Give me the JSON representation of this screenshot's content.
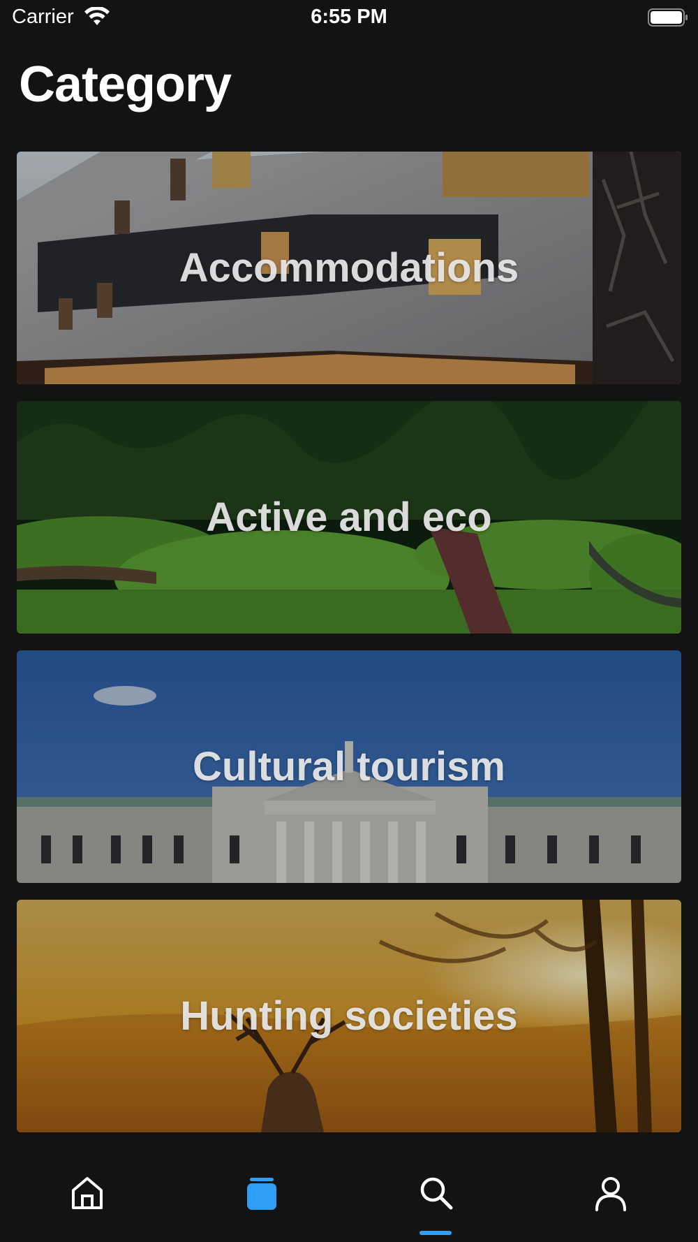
{
  "status_bar": {
    "carrier": "Carrier",
    "time": "6:55 PM",
    "wifi_icon": "wifi-icon",
    "battery_icon": "battery-full-icon"
  },
  "header": {
    "title": "Category"
  },
  "categories": [
    {
      "label": "Accommodations",
      "image": "modern-building-photo"
    },
    {
      "label": "Active and eco",
      "image": "green-park-path-photo"
    },
    {
      "label": "Cultural tourism",
      "image": "classical-building-photo"
    },
    {
      "label": "Hunting societies",
      "image": "deer-sunset-photo"
    }
  ],
  "tab_bar": {
    "items": [
      {
        "icon": "home-icon",
        "active": false
      },
      {
        "icon": "category-icon",
        "active": true
      },
      {
        "icon": "search-icon",
        "active": false
      },
      {
        "icon": "profile-icon",
        "active": false
      }
    ],
    "active_color": "#2f9ef4",
    "inactive_color": "#ffffff"
  }
}
